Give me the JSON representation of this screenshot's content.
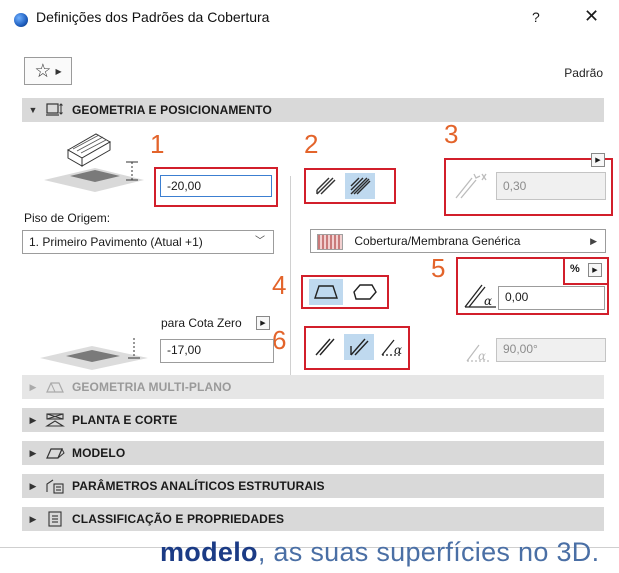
{
  "window": {
    "title": "Definições dos Padrões da Cobertura",
    "help": "?",
    "close": "✕"
  },
  "toolbar": {
    "preset_label": "Padrão"
  },
  "sections": {
    "geometry": "GEOMETRIA E POSICIONAMENTO",
    "multiplane": "GEOMETRIA MULTI-PLANO",
    "floorplan": "PLANTA E CORTE",
    "model": "MODELO",
    "structural": "PARÂMETROS ANALÍTICOS ESTRUTURAIS",
    "classification": "CLASSIFICAÇÃO E PROPRIEDADES"
  },
  "geometry": {
    "height_value": "-20,00",
    "home_story_label": "Piso de Origem:",
    "home_story_value": "1. Primeiro Pavimento (Atual +1)",
    "to_zero_label": "para Cota Zero",
    "to_zero_value": "-17,00",
    "thickness_value": "0,30",
    "material_value": "Cobertura/Membrana Genérica",
    "unit_label": "%",
    "slope_value": "0,00",
    "angle_value": "90,00°"
  },
  "callouts": [
    "1",
    "2",
    "3",
    "4",
    "5",
    "6"
  ],
  "footer": {
    "bold": "modelo",
    "rest": ", as suas superfícies no 3D."
  },
  "colors": {
    "highlight_red": "#d21f2b",
    "callout_orange": "#e3642b",
    "active_button": "#bfd9ef",
    "section_bar": "#d9d9d9"
  }
}
